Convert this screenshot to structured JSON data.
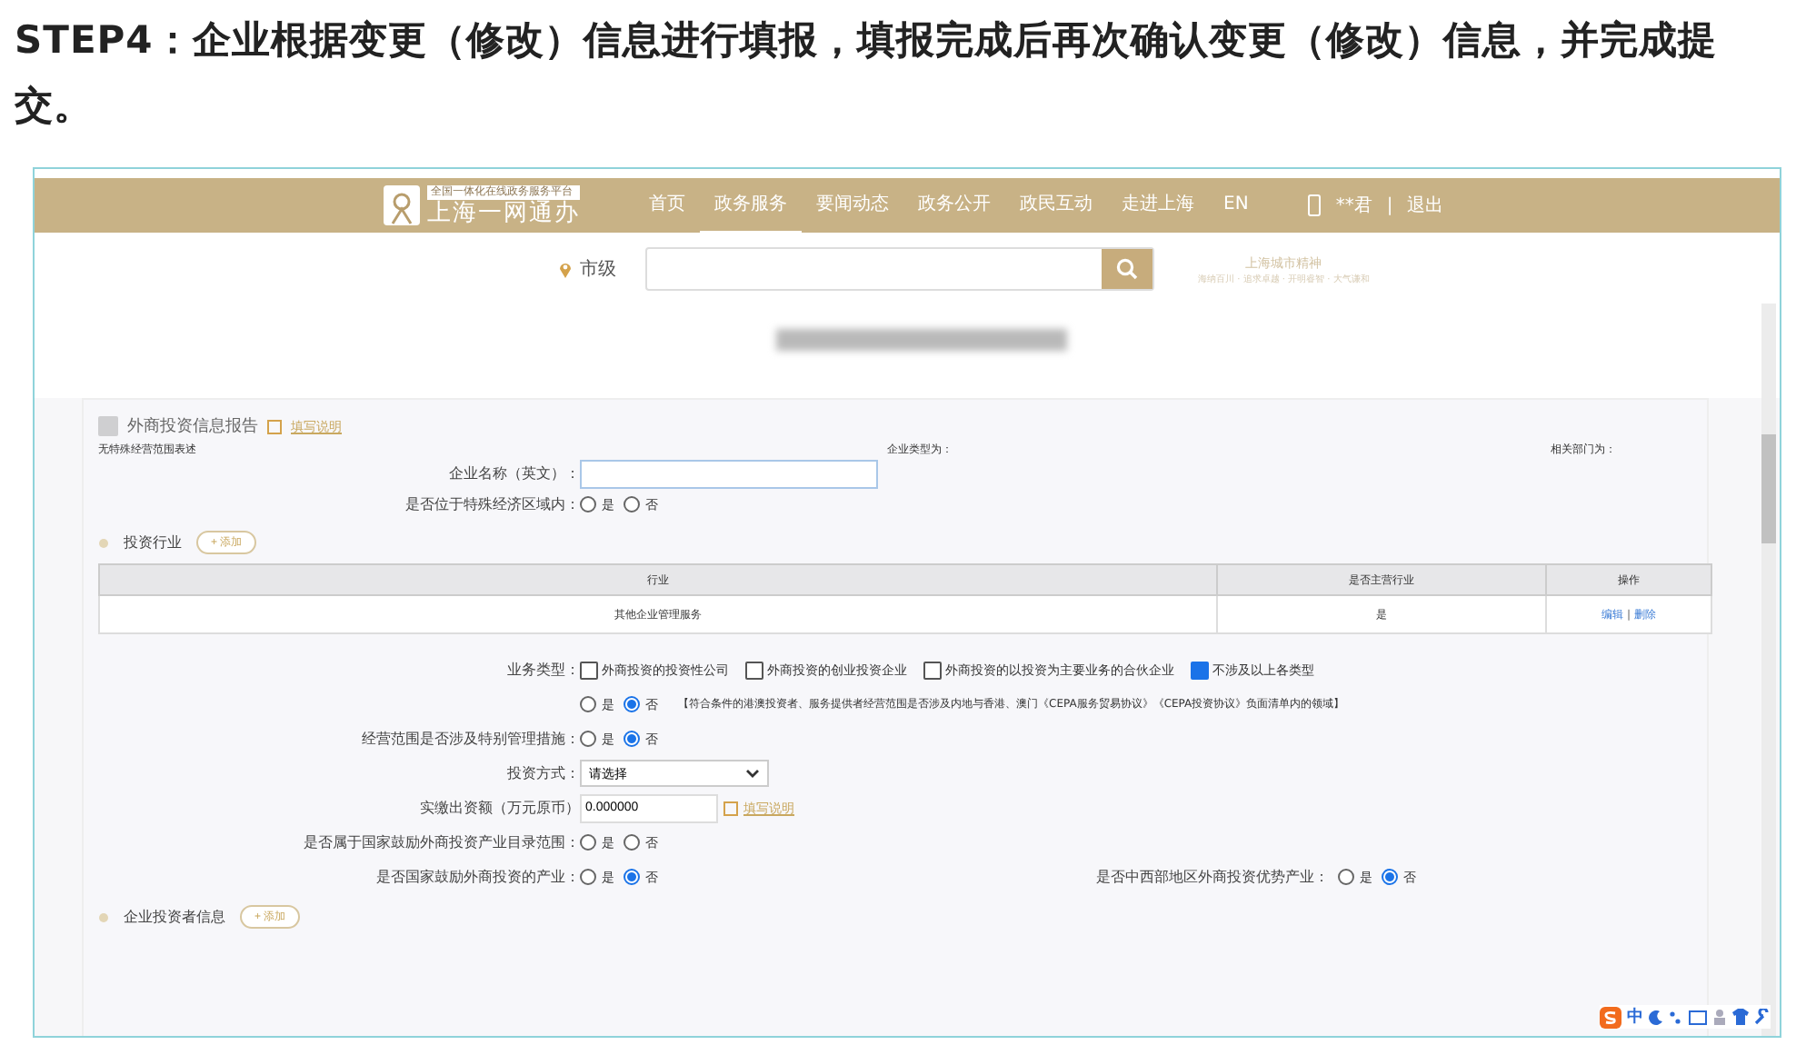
{
  "heading": "STEP4：企业根据变更（修改）信息进行填报，填报完成后再次确认变更（修改）信息，并完成提交。",
  "site": {
    "logo_tagline": "全国一体化在线政务服务平台",
    "logo_title": "上海一网通办",
    "nav": [
      {
        "label": "首页",
        "selected": false
      },
      {
        "label": "政务服务",
        "selected": true
      },
      {
        "label": "要闻动态",
        "selected": false
      },
      {
        "label": "政务公开",
        "selected": false
      },
      {
        "label": "政民互动",
        "selected": false
      },
      {
        "label": "走进上海",
        "selected": false
      },
      {
        "label": "EN",
        "selected": false
      }
    ],
    "user": "**君",
    "separator": "|",
    "logout": "退出",
    "location": "市级",
    "spirit_title": "上海城市精神",
    "spirit_text": "海纳百川 · 追求卓越 · 开明睿智 · 大气谦和"
  },
  "form": {
    "report": {
      "label": "外商投资信息报告",
      "checked": true,
      "disabled": true,
      "help": "填写说明"
    },
    "scope_note": "无特殊经营范围表述",
    "company_type": "企业类型为：",
    "department": "相关部门为：",
    "rows_top": [
      {
        "kind": "input",
        "label": "企业名称（英文）："
      },
      {
        "kind": "radio",
        "label": "是否位于特殊经济区域内：",
        "options": [
          {
            "label": "是",
            "selected": false
          },
          {
            "label": "否",
            "selected": false
          }
        ]
      }
    ],
    "industry": {
      "title": "投资行业",
      "add": "+ 添加",
      "columns": [
        "行业",
        "是否主营行业",
        "操作"
      ],
      "rows": [
        {
          "industry": "其他企业管理服务",
          "main": "是",
          "edit": "编辑",
          "sep": "|",
          "delete": "删除"
        }
      ]
    },
    "rows": [
      {
        "kind": "checkboxes",
        "label": "业务类型：",
        "options": [
          {
            "label": "外商投资的投资性公司",
            "checked": false
          },
          {
            "label": "外商投资的创业投资企业",
            "checked": false
          },
          {
            "label": "外商投资的以投资为主要业务的合伙企业",
            "checked": false
          },
          {
            "label": "不涉及以上各类型",
            "checked": true
          }
        ]
      },
      {
        "kind": "radio",
        "label": "",
        "options": [
          {
            "label": "是",
            "selected": false
          },
          {
            "label": "否",
            "selected": true
          }
        ],
        "note": "【符合条件的港澳投资者、服务提供者经营范围是否涉及内地与香港、澳门《CEPA服务贸易协议》《CEPA投资协议》负面清单内的领域】"
      },
      {
        "kind": "radio",
        "label": "经营范围是否涉及特别管理措施：",
        "options": [
          {
            "label": "是",
            "selected": false
          },
          {
            "label": "否",
            "selected": true
          }
        ]
      },
      {
        "kind": "select",
        "label": "投资方式：",
        "value": "请选择"
      },
      {
        "kind": "input",
        "label": "实缴出资额（万元原币）",
        "value": "0.000000",
        "help": "填写说明"
      },
      {
        "kind": "radio",
        "label": "是否属于国家鼓励外商投资产业目录范围：",
        "options": [
          {
            "label": "是",
            "selected": false
          },
          {
            "label": "否",
            "selected": false
          }
        ]
      },
      {
        "kind": "pair",
        "label": "是否国家鼓励外商投资的产业：",
        "options": [
          {
            "label": "是",
            "selected": false
          },
          {
            "label": "否",
            "selected": true
          }
        ],
        "label2": "是否中西部地区外商投资优势产业：",
        "options2": [
          {
            "label": "是",
            "selected": false
          },
          {
            "label": "否",
            "selected": true
          }
        ]
      }
    ],
    "investors": {
      "title": "企业投资者信息",
      "add": "+ 添加"
    }
  },
  "ime_toolbar": {
    "lang": "中"
  }
}
